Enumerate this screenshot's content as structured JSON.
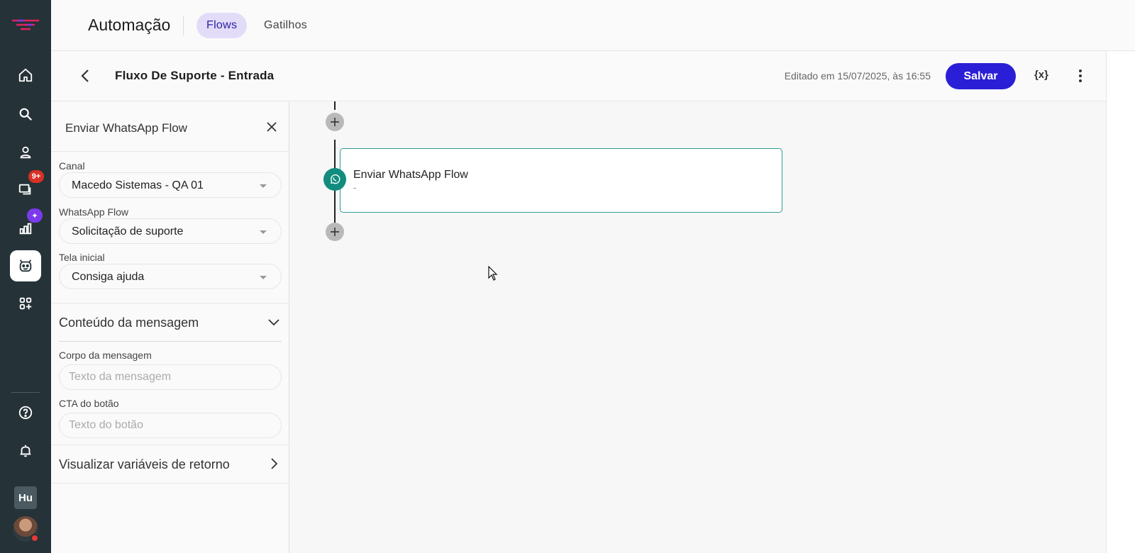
{
  "topbar": {
    "title": "Automação",
    "tabs": [
      {
        "label": "Flows",
        "active": true
      },
      {
        "label": "Gatilhos",
        "active": false
      }
    ]
  },
  "rail": {
    "items": [
      {
        "name": "home-icon"
      },
      {
        "name": "search-icon"
      },
      {
        "name": "contacts-icon"
      },
      {
        "name": "chat-icon",
        "badge": "9+"
      },
      {
        "name": "reports-icon",
        "badge": "✦"
      },
      {
        "name": "bot-icon",
        "active": true
      },
      {
        "name": "apps-icon"
      },
      {
        "name": "help-icon"
      },
      {
        "name": "bell-icon"
      }
    ],
    "workspace_initials": "Hu"
  },
  "subbar": {
    "flow_name": "Fluxo De Suporte - Entrada",
    "edited": "Editado em 15/07/2025, às 16:55",
    "save_label": "Salvar",
    "vars_label": "{x}"
  },
  "panel": {
    "title": "Enviar WhatsApp Flow",
    "canal": {
      "label": "Canal",
      "value": "Macedo Sistemas - QA 01"
    },
    "whatsapp_flow": {
      "label": "WhatsApp Flow",
      "value": "Solicitação de suporte"
    },
    "tela_inicial": {
      "label": "Tela inicial",
      "value": "Consiga ajuda"
    },
    "content_section": "Conteúdo da mensagem",
    "corpo": {
      "label": "Corpo da mensagem",
      "placeholder": "Texto da mensagem"
    },
    "cta": {
      "label": "CTA do botão",
      "placeholder": "Texto do botão"
    },
    "return_vars": "Visualizar variáveis de retorno"
  },
  "canvas": {
    "node": {
      "title": "Enviar WhatsApp Flow",
      "subtitle": "-"
    }
  },
  "colors": {
    "rail_bg": "#253238",
    "accent": "#2a1fd6",
    "tab_active_bg": "#e3dcf9",
    "node_border": "#2e9b94",
    "whatsapp": "#128c7e",
    "badge_red": "#d93025",
    "badge_purple": "#7c3aed"
  }
}
